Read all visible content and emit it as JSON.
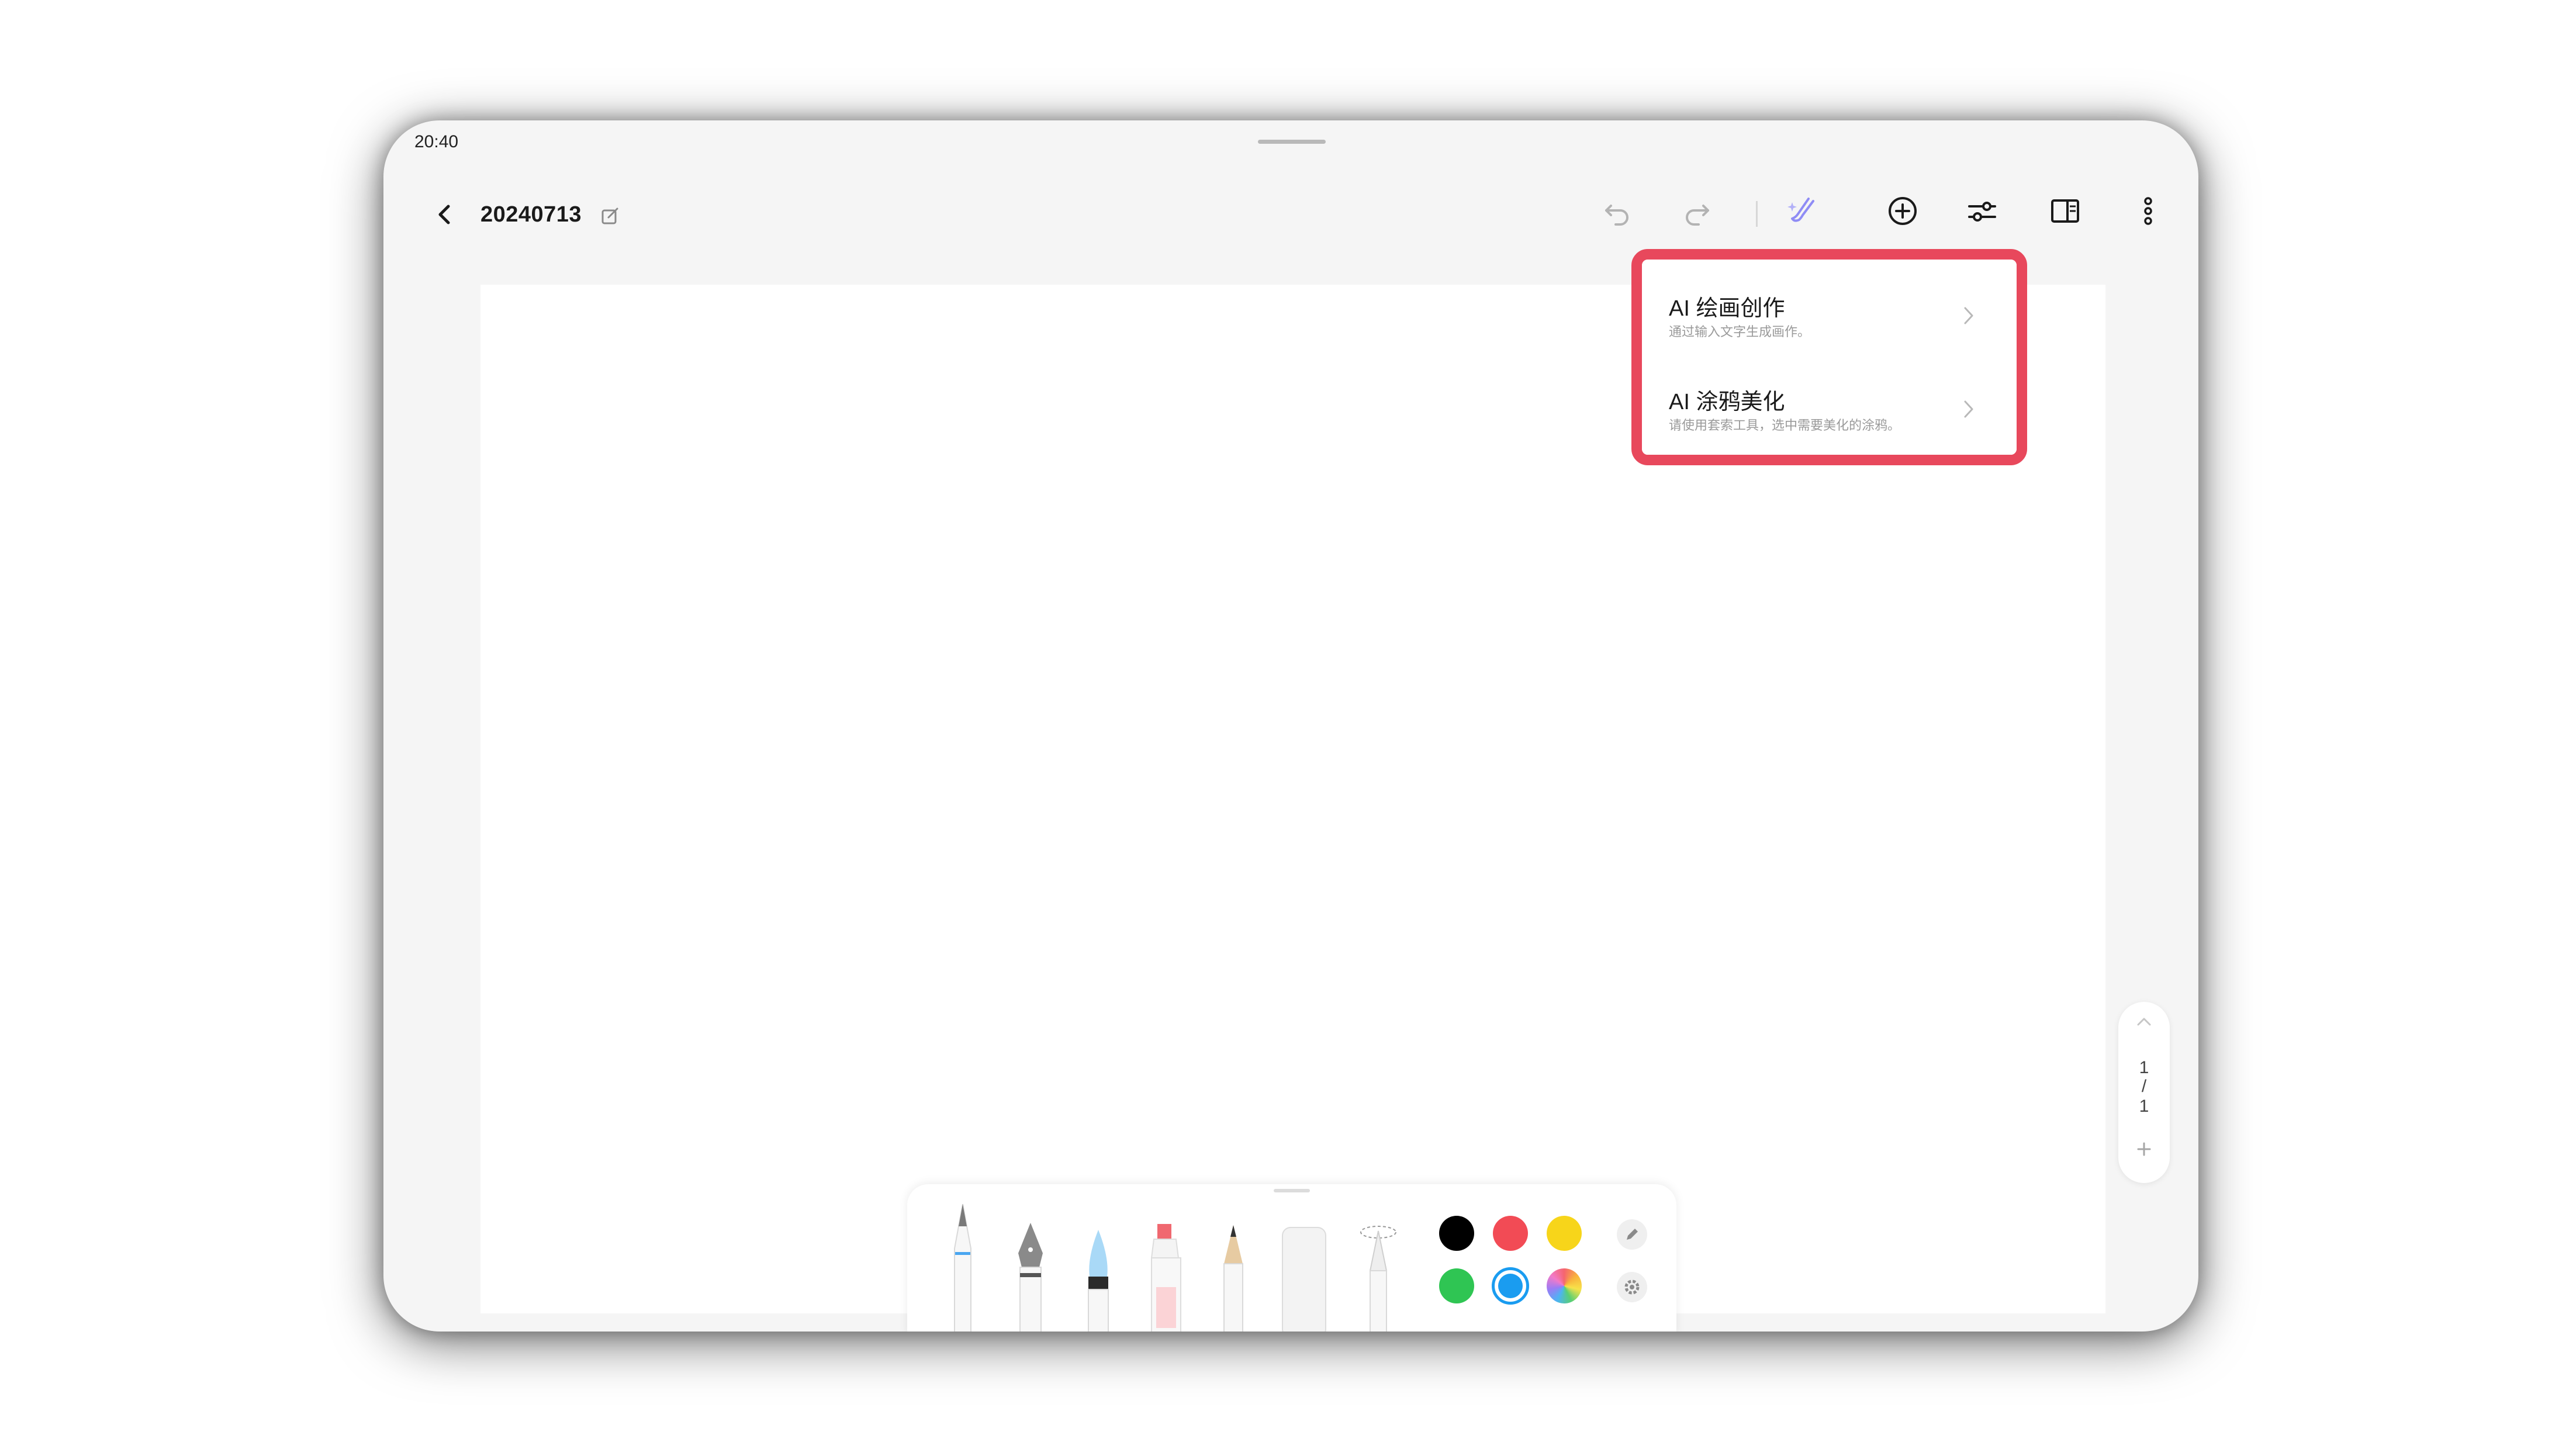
{
  "status_bar": {
    "time": "20:40"
  },
  "header": {
    "title": "20240713",
    "icons": [
      "back-icon",
      "edit-title-icon",
      "undo-icon",
      "redo-icon",
      "ai-brush-icon",
      "add-icon",
      "adjust-icon",
      "split-view-icon",
      "more-icon"
    ]
  },
  "ai_menu": {
    "items": [
      {
        "title": "AI 绘画创作",
        "description": "通过输入文字生成画作。"
      },
      {
        "title": "AI 涂鸦美化",
        "description": "请使用套索工具，选中需要美化的涂鸦。"
      }
    ]
  },
  "pager": {
    "current": "1",
    "separator": "/",
    "total": "1"
  },
  "tools": {
    "pens": [
      "ballpoint-pen",
      "fountain-pen",
      "brush-pen",
      "highlighter",
      "pencil",
      "eraser",
      "lasso-tool"
    ],
    "colors": {
      "black": "#000000",
      "red": "#f24b55",
      "yellow": "#f7d51a",
      "green": "#2fc553",
      "blue": "#1a9cf0",
      "selected": "blue"
    }
  },
  "colors": {
    "accent": "#e8485c",
    "ai_icon": "#8f8cf5"
  }
}
